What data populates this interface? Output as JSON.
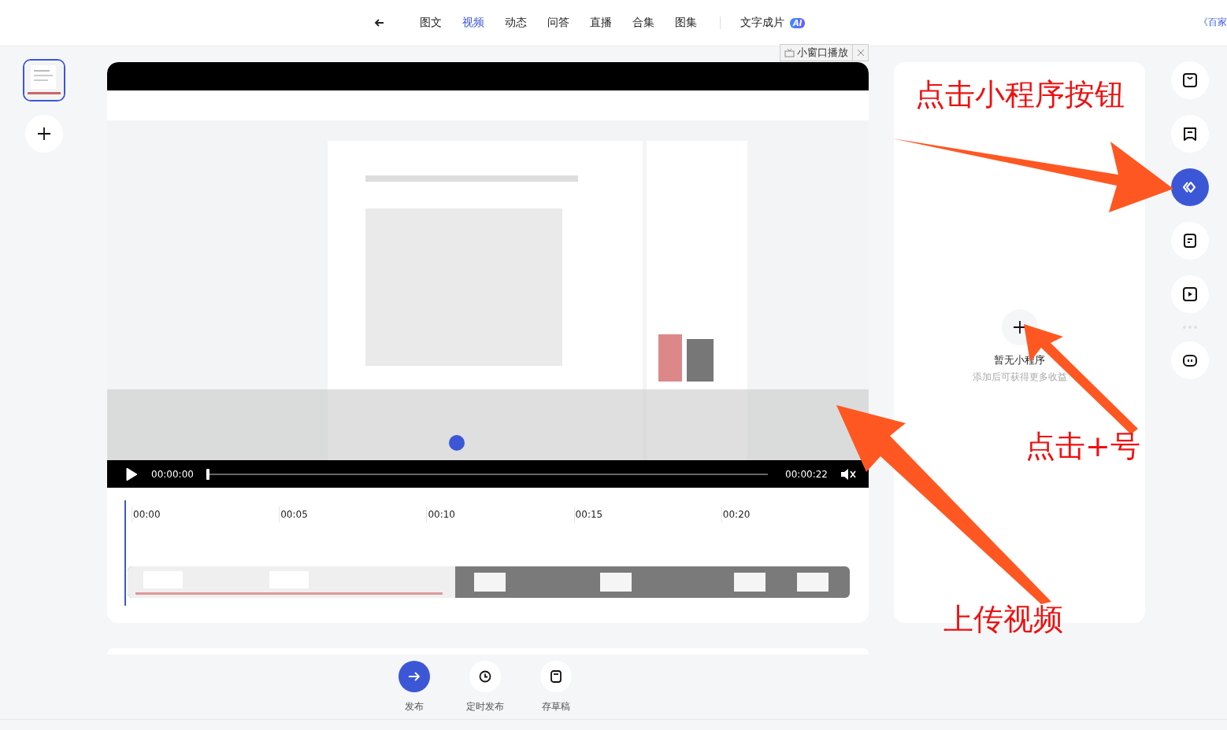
{
  "nav": {
    "tabs": [
      {
        "label": "图文",
        "selected": false
      },
      {
        "label": "视频",
        "selected": true
      },
      {
        "label": "动态",
        "selected": false
      },
      {
        "label": "问答",
        "selected": false
      },
      {
        "label": "直播",
        "selected": false
      },
      {
        "label": "合集",
        "selected": false
      },
      {
        "label": "图集",
        "selected": false
      }
    ],
    "ai_item": {
      "label": "文字成片",
      "badge": "AI"
    },
    "right_link": "《百家"
  },
  "clips": [
    {
      "kind": "picture",
      "selected": true
    }
  ],
  "mini_player": {
    "label": "小窗口播放"
  },
  "video": {
    "kind": "picture",
    "current_time": "00:00:00",
    "duration": "00:00:22",
    "playing": false,
    "muted": true,
    "level": 0
  },
  "timeline": {
    "ticks": [
      "00:00",
      "00:05",
      "00:10",
      "00:15",
      "00:20"
    ]
  },
  "mini_program_panel": {
    "empty_title": "暂无小程序",
    "empty_hint": "添加后可获得更多收益"
  },
  "side_tools": [
    {
      "kind": "bag",
      "selected": false
    },
    {
      "kind": "comment",
      "selected": false
    },
    {
      "kind": "miniapp",
      "selected": true
    },
    {
      "kind": "doc",
      "selected": false
    },
    {
      "kind": "play",
      "selected": false
    },
    {
      "kind": "robot",
      "selected": false
    }
  ],
  "actions": [
    {
      "kind": "publish",
      "label": "发布"
    },
    {
      "kind": "schedule",
      "label": "定时发布"
    },
    {
      "kind": "draft",
      "label": "存草稿"
    }
  ],
  "annotations": [
    {
      "text": "点击小程序按钮"
    },
    {
      "text": "点击+号"
    },
    {
      "text": "上传视频"
    }
  ]
}
